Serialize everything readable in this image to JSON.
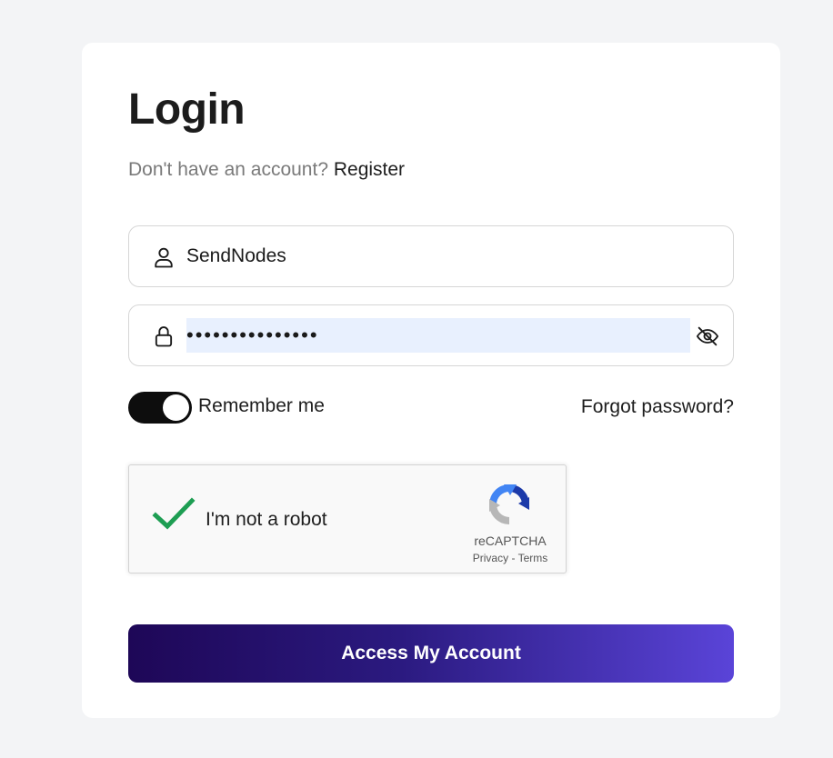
{
  "login": {
    "title": "Login",
    "no_account_text": "Don't have an account?",
    "register_link": "Register",
    "username": {
      "value": "SendNodes",
      "icon": "user-icon"
    },
    "password": {
      "value": "•••••••••••••••",
      "icon": "lock-icon",
      "toggle_icon": "eye-slash-icon"
    },
    "remember_me": {
      "label": "Remember me",
      "checked": true
    },
    "forgot_password": "Forgot password?",
    "recaptcha": {
      "label": "I'm not a robot",
      "checked": true,
      "brand": "reCAPTCHA",
      "privacy": "Privacy",
      "separator": " - ",
      "terms": "Terms"
    },
    "submit_label": "Access My Account"
  },
  "colors": {
    "page_background": "#f3f4f6",
    "card_background": "#ffffff",
    "autofill_highlight": "#e8f0fe",
    "toggle_on": "#0d0d0d",
    "button_gradient_start": "#1e0757",
    "button_gradient_end": "#5a44d8",
    "check_green": "#1e9e53"
  }
}
